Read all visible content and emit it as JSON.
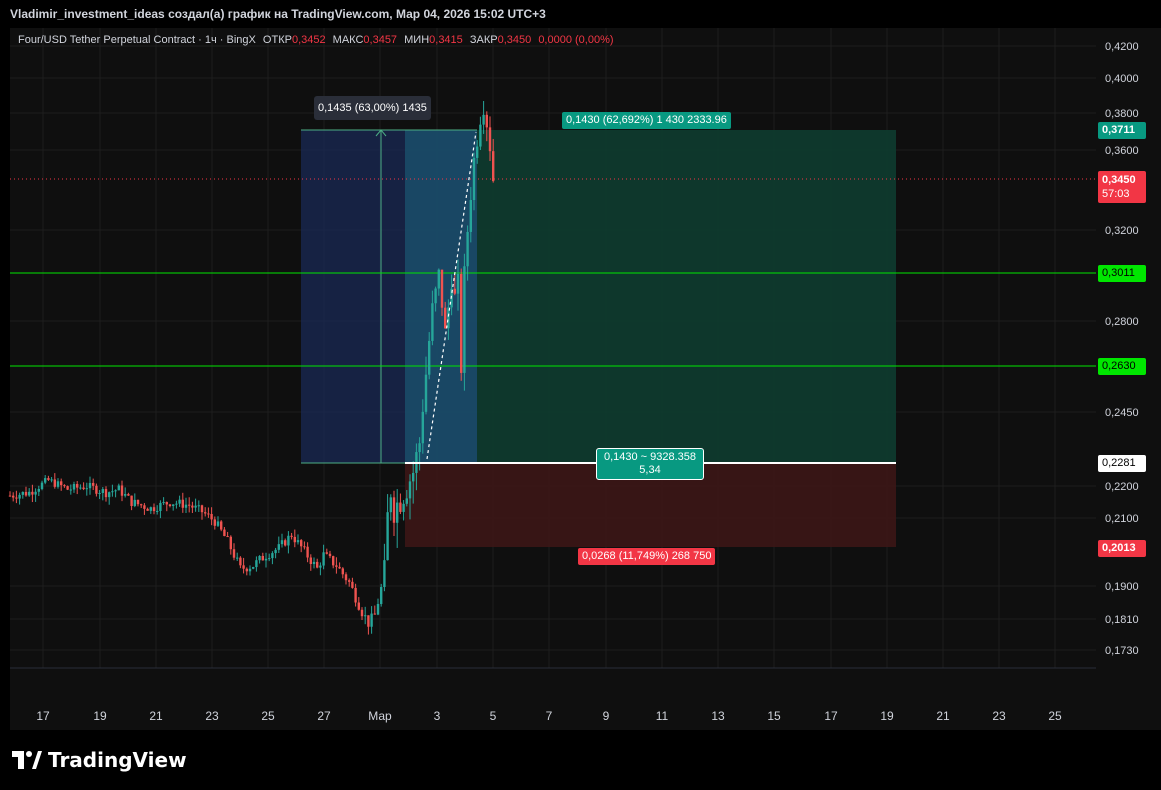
{
  "header": {
    "title": "Vladimir_investment_ideas создал(а) график на TradingView.com, Мар 04, 2026 15:02 UTC+3"
  },
  "legend": {
    "symbol": "Four/USD Tether Perpetual Contract · 1ч · BingX",
    "open_label": "ОТКР",
    "open": "0,3452",
    "high_label": "МАКС",
    "high": "0,3457",
    "low_label": "МИН",
    "low": "0,3415",
    "close_label": "ЗАКР",
    "close": "0,3450",
    "change": "0,0000 (0,00%)"
  },
  "measure": {
    "label": "0,1435 (63,00%) 1435"
  },
  "position": {
    "target_label": "0,1430 (62,692%) 1 430 2333.96",
    "entry_label_line1": "0,1430 ~ 9328.358",
    "entry_label_line2": "5,34",
    "stop_label": "0,0268 (11,749%) 268 750"
  },
  "price_tags": {
    "target": "0,3711",
    "current": "0,3450",
    "countdown": "57:03",
    "line1": "0,3011",
    "line2": "0,2630",
    "entry": "0,2281",
    "stop": "0,2013"
  },
  "footer": {
    "logo_text": "TradingView"
  },
  "colors": {
    "bull": "#26a69a",
    "bear": "#ef5350",
    "hline": "#00e600",
    "target_zone": "#0f3a2e",
    "stop_zone": "#3a1616",
    "measure_zone": "#1a2a55"
  },
  "chart_data": {
    "type": "candlestick",
    "timeframe": "1h",
    "x_ticks": [
      "17",
      "19",
      "21",
      "23",
      "25",
      "27",
      "Мар",
      "3",
      "5",
      "7",
      "9",
      "11",
      "13",
      "15",
      "17",
      "19",
      "21",
      "23",
      "25"
    ],
    "y_ticks": [
      "0,4200",
      "0,4000",
      "0,3800",
      "0,3600",
      "0,3200",
      "0,2800",
      "0,2450",
      "0,2200",
      "0,2100",
      "0,1900",
      "0,1810",
      "0,1730"
    ],
    "y_tick_values": [
      0.42,
      0.4,
      0.38,
      0.36,
      0.32,
      0.28,
      0.245,
      0.22,
      0.21,
      0.19,
      0.181,
      0.173
    ],
    "horizontal_lines": [
      0.3011,
      0.263
    ],
    "entry_price": 0.2281,
    "target_price": 0.3711,
    "stop_price": 0.2013,
    "current_price": 0.345,
    "price_path": [
      [
        0,
        0.217
      ],
      [
        6,
        0.218
      ],
      [
        12,
        0.222
      ],
      [
        18,
        0.219
      ],
      [
        24,
        0.22
      ],
      [
        30,
        0.218
      ],
      [
        34,
        0.219
      ],
      [
        38,
        0.215
      ],
      [
        44,
        0.213
      ],
      [
        50,
        0.215
      ],
      [
        56,
        0.214
      ],
      [
        60,
        0.212
      ],
      [
        64,
        0.209
      ],
      [
        68,
        0.203
      ],
      [
        72,
        0.195
      ],
      [
        76,
        0.196
      ],
      [
        80,
        0.199
      ],
      [
        84,
        0.201
      ],
      [
        88,
        0.205
      ],
      [
        92,
        0.2
      ],
      [
        96,
        0.195
      ],
      [
        98,
        0.199
      ],
      [
        102,
        0.196
      ],
      [
        106,
        0.191
      ],
      [
        110,
        0.183
      ],
      [
        112,
        0.18
      ],
      [
        114,
        0.182
      ],
      [
        117,
        0.193
      ],
      [
        118,
        0.21
      ],
      [
        119,
        0.219
      ],
      [
        120,
        0.213
      ],
      [
        122,
        0.216
      ],
      [
        124,
        0.22
      ],
      [
        126,
        0.225
      ],
      [
        128,
        0.235
      ],
      [
        130,
        0.26
      ],
      [
        132,
        0.285
      ],
      [
        133,
        0.292
      ],
      [
        134,
        0.3
      ],
      [
        135,
        0.288
      ],
      [
        136,
        0.275
      ],
      [
        137,
        0.286
      ],
      [
        138,
        0.299
      ],
      [
        139,
        0.29
      ],
      [
        140,
        0.296
      ],
      [
        141,
        0.263
      ],
      [
        142,
        0.3
      ],
      [
        143,
        0.32
      ],
      [
        144,
        0.338
      ],
      [
        145,
        0.355
      ],
      [
        146,
        0.366
      ],
      [
        147,
        0.378
      ],
      [
        148,
        0.384
      ],
      [
        149,
        0.375
      ],
      [
        150,
        0.362
      ],
      [
        151,
        0.345
      ]
    ]
  }
}
